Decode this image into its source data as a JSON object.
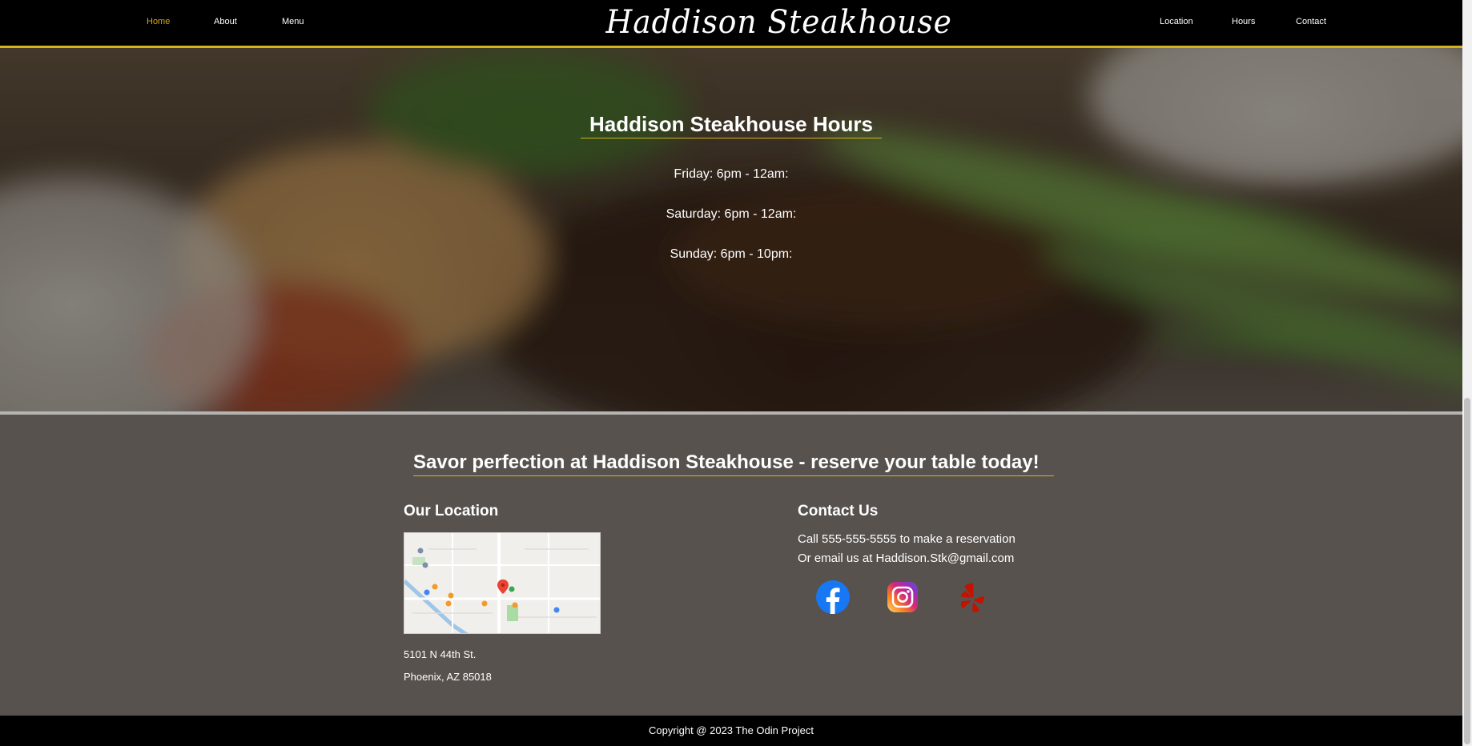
{
  "nav": {
    "left": [
      {
        "label": "Home",
        "active": true
      },
      {
        "label": "About"
      },
      {
        "label": "Menu"
      }
    ],
    "brand": "Haddison Steakhouse",
    "right": [
      {
        "label": "Location"
      },
      {
        "label": "Hours"
      },
      {
        "label": "Contact"
      }
    ]
  },
  "hours": {
    "title": "Haddison Steakhouse Hours",
    "lines": [
      "Friday: 6pm - 12am:",
      "Saturday: 6pm - 12am:",
      "Sunday: 6pm - 10pm:"
    ]
  },
  "contact_section": {
    "cta": "Savor perfection at Haddison Steakhouse - reserve your table today!",
    "location": {
      "title": "Our Location",
      "address_line1": "5101 N 44th St.",
      "address_line2": "Phoenix, AZ 85018"
    },
    "contact": {
      "title": "Contact Us",
      "phone_line": "Call 555-555-5555 to make a reservation",
      "email_line": "Or email us at Haddison.Stk@gmail.com"
    },
    "social_icons": [
      "facebook-icon",
      "instagram-icon",
      "yelp-icon"
    ]
  },
  "footer": {
    "copyright": "Copyright @ 2023 The Odin Project"
  },
  "colors": {
    "accent": "#d4b21e",
    "active_nav": "#d4a51a",
    "section_bg": "#58524e"
  }
}
